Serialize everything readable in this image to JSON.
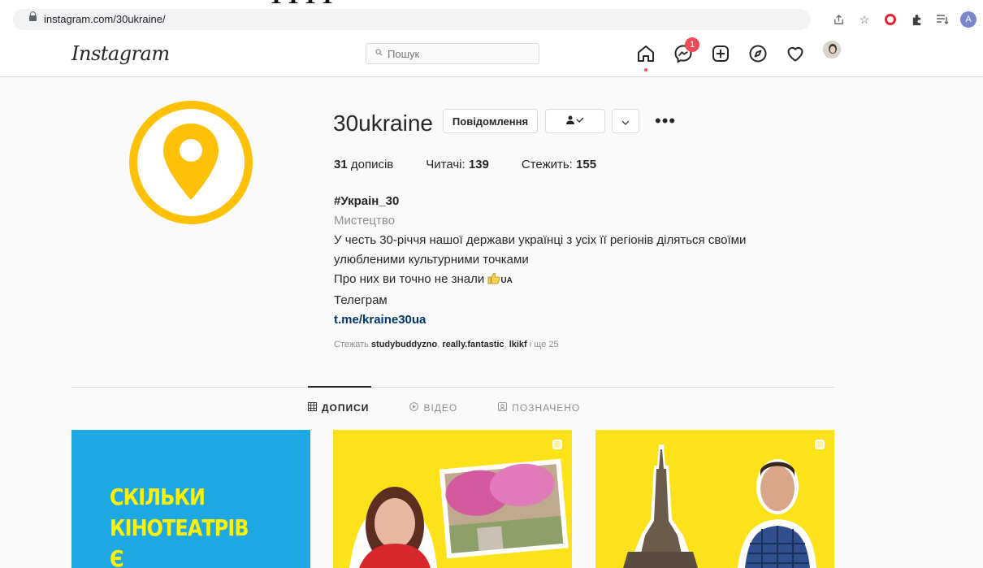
{
  "browser": {
    "url": "instagram.com/30ukraine/"
  },
  "nav": {
    "logo": "Instagram",
    "search_placeholder": "Пошук",
    "messages_badge": "1"
  },
  "profile": {
    "username": "30ukraine",
    "message_button": "Повідомлення",
    "stats": {
      "posts_count": "31",
      "posts_label": "дописів",
      "followers_label": "Читачі:",
      "followers_count": "139",
      "following_label": "Стежить:",
      "following_count": "155"
    },
    "bio": {
      "name": "#Украін_30",
      "category": "Мистецтво",
      "line1": "У честь 30-річчя нашої держави українці з усіх її регіонів діляться своїми",
      "line2": "улюбленими культурними точками",
      "line3": "Про них ви точно не знали",
      "line3_suffix": "UA",
      "line4": "Телеграм",
      "link": "t.me/kraine30ua"
    },
    "followed_by": {
      "prefix": "Стежать",
      "user1": "studybuddyzno",
      "user2": "really.fantastic",
      "user3": "lkikf",
      "suffix": "і ще 25"
    }
  },
  "tabs": [
    {
      "label": "ДОПИСИ"
    },
    {
      "label": "ВІДЕО"
    },
    {
      "label": "ПОЗНАЧЕНО"
    }
  ],
  "posts": [
    {
      "line1": "СКІЛЬКИ",
      "line2": "КІНОТЕАТРІВ",
      "line3": "Є"
    }
  ],
  "colors": {
    "accent_yellow": "#ffc107",
    "tile_blue": "#1ea9e4",
    "tile_yellow": "#fbe21b",
    "badge_red": "#ed4956",
    "link_blue": "#00376b"
  }
}
